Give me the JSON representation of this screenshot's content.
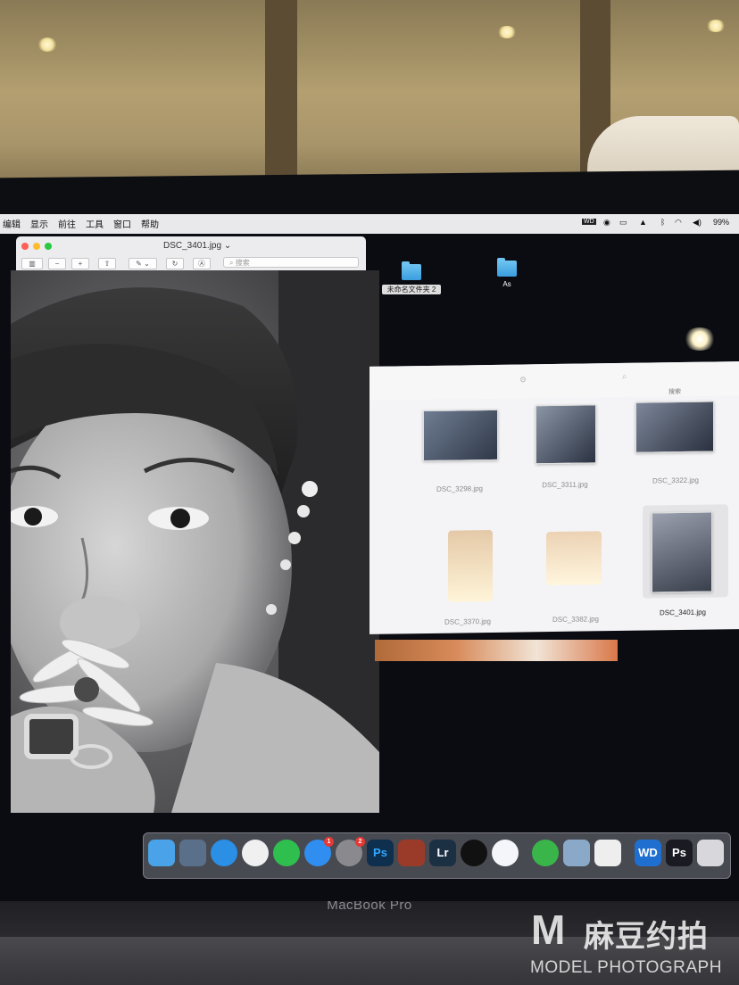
{
  "menubar": {
    "items": [
      "编辑",
      "显示",
      "前往",
      "工具",
      "窗口",
      "帮助"
    ],
    "status": {
      "wd_label": "WD",
      "battery": "99%"
    }
  },
  "preview": {
    "title": "DSC_3401.jpg ⌄",
    "search_placeholder": "搜索",
    "toolbar_icons": [
      "sidebar-icon",
      "zoom-out-icon",
      "zoom-in-icon",
      "share-icon",
      "markup-icon",
      "rotate-icon",
      "annotate-icon"
    ]
  },
  "desktop": {
    "folders": [
      {
        "label": "未命名文件夹 2"
      },
      {
        "label": "As"
      }
    ]
  },
  "finder": {
    "search_placeholder": "搜索",
    "files": [
      {
        "name": "DSC_3298.jpg",
        "selected": false
      },
      {
        "name": "DSC_3311.jpg",
        "selected": false
      },
      {
        "name": "DSC_3322.jpg",
        "selected": false
      },
      {
        "name": "DSC_3370.jpg",
        "selected": false
      },
      {
        "name": "DSC_3382.jpg",
        "selected": false
      },
      {
        "name": "DSC_3401.jpg",
        "selected": true
      }
    ]
  },
  "dock": {
    "apps": [
      {
        "name": "finder-icon",
        "label": "",
        "color": "#4aa3e8"
      },
      {
        "name": "launchpad-icon",
        "label": "",
        "color": "#5a6f8a"
      },
      {
        "name": "safari-icon",
        "label": "",
        "color": "#2b8fe6"
      },
      {
        "name": "photos-icon",
        "label": "",
        "color": "#f0f0f0"
      },
      {
        "name": "wechat-icon",
        "label": "",
        "color": "#2fbf4f"
      },
      {
        "name": "app-store-icon",
        "label": "",
        "color": "#2f8ef0",
        "badge": "1"
      },
      {
        "name": "system-preferences-icon",
        "label": "",
        "color": "#8a8a8e",
        "badge": "2"
      },
      {
        "name": "photoshop-icon",
        "label": "Ps",
        "color": "#0f2f4e"
      },
      {
        "name": "photo-booth-icon",
        "label": "",
        "color": "#9a3b2a"
      },
      {
        "name": "lightroom-icon",
        "label": "Lr",
        "color": "#1c3044"
      },
      {
        "name": "qq-icon",
        "label": "",
        "color": "#111111"
      },
      {
        "name": "baidu-netdisk-icon",
        "label": "",
        "color": "#f4f6fa"
      },
      {
        "name": "send-icon",
        "label": "",
        "color": "#39b54a"
      },
      {
        "name": "preview-icon",
        "label": "",
        "color": "#8aa8c8"
      },
      {
        "name": "document-icon",
        "label": "",
        "color": "#eeeeee"
      },
      {
        "name": "wd-drive-icon",
        "label": "WD",
        "color": "#1f6fd0"
      },
      {
        "name": "minimized-photoshop-icon",
        "label": "Ps",
        "color": "#1a1a22"
      },
      {
        "name": "trash-icon",
        "label": "",
        "color": "#d8d8dc"
      }
    ]
  },
  "device": {
    "label": "MacBook Pro"
  },
  "watermark": {
    "mark": "M",
    "cn": "麻豆约拍",
    "en": "MODEL PHOTOGRAPH"
  }
}
